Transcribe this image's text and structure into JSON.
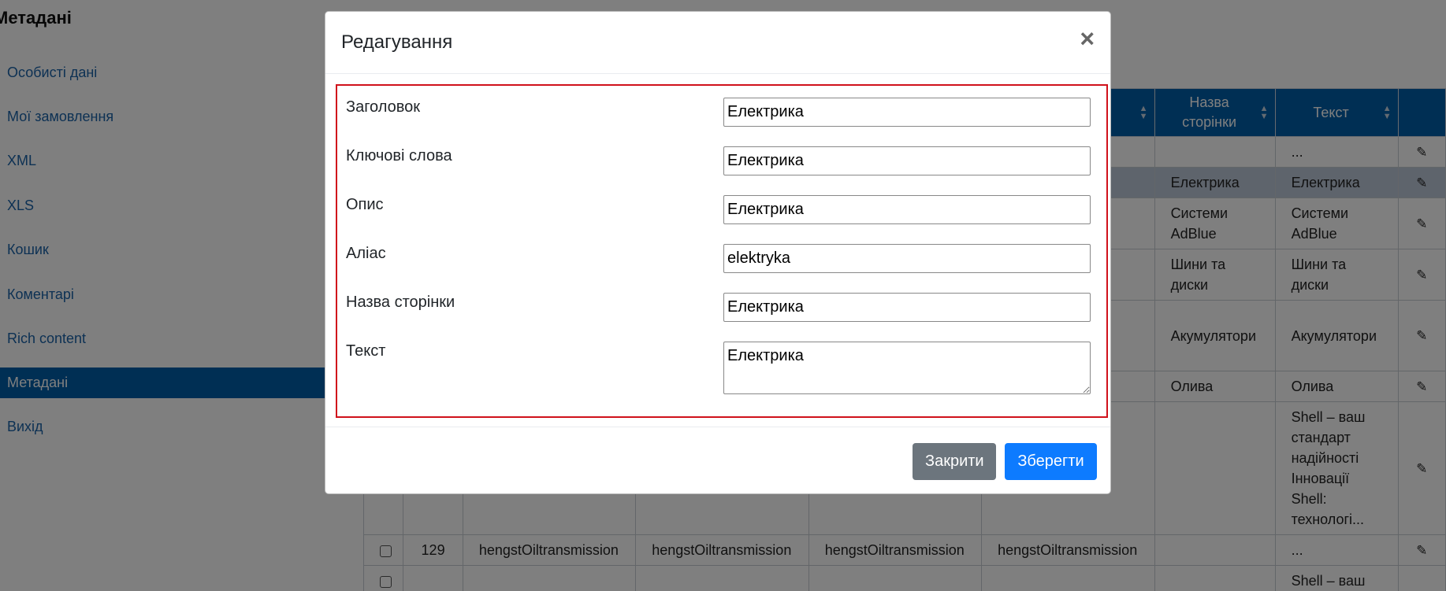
{
  "page": {
    "title": "Метадані"
  },
  "sidebar": {
    "items": [
      {
        "label": "Особисті дані"
      },
      {
        "label": "Мої замовлення"
      },
      {
        "label": "XML"
      },
      {
        "label": "XLS"
      },
      {
        "label": "Кошик"
      },
      {
        "label": "Коментарі"
      },
      {
        "label": "Rich content"
      },
      {
        "label": "Метадані",
        "active": true
      },
      {
        "label": "Вихід"
      }
    ]
  },
  "table": {
    "headers": [
      "",
      "",
      "",
      "",
      "",
      "",
      "Назва сторінки",
      "Текст",
      ""
    ],
    "rows": [
      {
        "id": "",
        "c1": "",
        "c2": "",
        "c3": "",
        "c4": "",
        "page_name": "",
        "text": "...",
        "selected": false
      },
      {
        "id": "",
        "c1": "",
        "c2": "",
        "c3": "",
        "c4": "",
        "page_name": "Електрика",
        "text": "Електрика",
        "selected": true
      },
      {
        "id": "",
        "c1": "",
        "c2": "",
        "c3": "",
        "c4": "",
        "page_name": "Системи AdBlue",
        "text": "Системи AdBlue",
        "selected": false
      },
      {
        "id": "",
        "c1": "",
        "c2": "",
        "c3": "",
        "c4": "",
        "page_name": "Шини та диски",
        "text": "Шини та диски",
        "selected": false
      },
      {
        "id": "",
        "c1": "",
        "c2": "",
        "c3": "",
        "c4": "",
        "page_name": "Акумулятори",
        "text": "Акумулятори",
        "selected": false
      },
      {
        "id": "",
        "c1": "",
        "c2": "",
        "c3": "",
        "c4": "",
        "page_name": "Олива",
        "text": "Олива",
        "selected": false
      },
      {
        "id": "",
        "c1": "",
        "c2": "",
        "c3": "",
        "c4": "",
        "page_name": "",
        "text": "Shell – ваш стандарт надійності Інновації Shell: технологі...",
        "selected": false
      },
      {
        "id": "129",
        "c1": "hengstOiltransmission",
        "c2": "hengstOiltransmission",
        "c3": "hengstOiltransmission",
        "c4": "hengstOiltransmission",
        "page_name": "",
        "text": "...",
        "selected": false
      },
      {
        "id": "",
        "c1": "",
        "c2": "",
        "c3": "",
        "c4": "",
        "page_name": "",
        "text": "Shell – ваш стандарт",
        "selected": false
      }
    ]
  },
  "modal": {
    "title": "Редагування",
    "close_symbol": "×",
    "fields": [
      {
        "label": "Заголовок",
        "value": "Електрика"
      },
      {
        "label": "Ключові слова",
        "value": "Електрика"
      },
      {
        "label": "Опис",
        "value": "Електрика"
      },
      {
        "label": "Аліас",
        "value": "elektryka"
      },
      {
        "label": "Назва сторінки",
        "value": "Електрика"
      },
      {
        "label": "Текст",
        "value": "Електрика"
      }
    ],
    "close_label": "Закрити",
    "save_label": "Зберегти"
  },
  "icons": {
    "edit": "pencil-icon",
    "sort": "sort-icon",
    "close": "close-icon"
  }
}
